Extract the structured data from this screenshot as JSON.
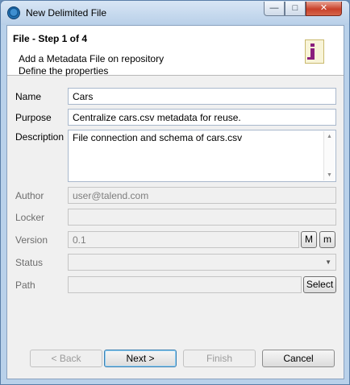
{
  "window": {
    "title": "New Delimited File",
    "min_glyph": "—",
    "max_glyph": "□",
    "close_glyph": "✕"
  },
  "header": {
    "step_title": "File - Step 1 of 4",
    "line1": "Add a Metadata File on repository",
    "line2": "Define the properties",
    "icon": "metadata-file-icon"
  },
  "form": {
    "name_label": "Name",
    "name_value": "Cars",
    "purpose_label": "Purpose",
    "purpose_value": "Centralize cars.csv metadata for reuse.",
    "description_label": "Description",
    "description_value": "File connection and schema of cars.csv",
    "author_label": "Author",
    "author_value": "user@talend.com",
    "locker_label": "Locker",
    "locker_value": "",
    "version_label": "Version",
    "version_value": "0.1",
    "major_button": "M",
    "minor_button": "m",
    "status_label": "Status",
    "status_value": "",
    "path_label": "Path",
    "path_value": "",
    "select_button": "Select"
  },
  "footer": {
    "back": "< Back",
    "next": "Next >",
    "finish": "Finish",
    "cancel": "Cancel"
  },
  "colors": {
    "title_bar": "#b8cfe8",
    "close_button": "#c8412a",
    "focus_border": "#3c7fb1"
  }
}
